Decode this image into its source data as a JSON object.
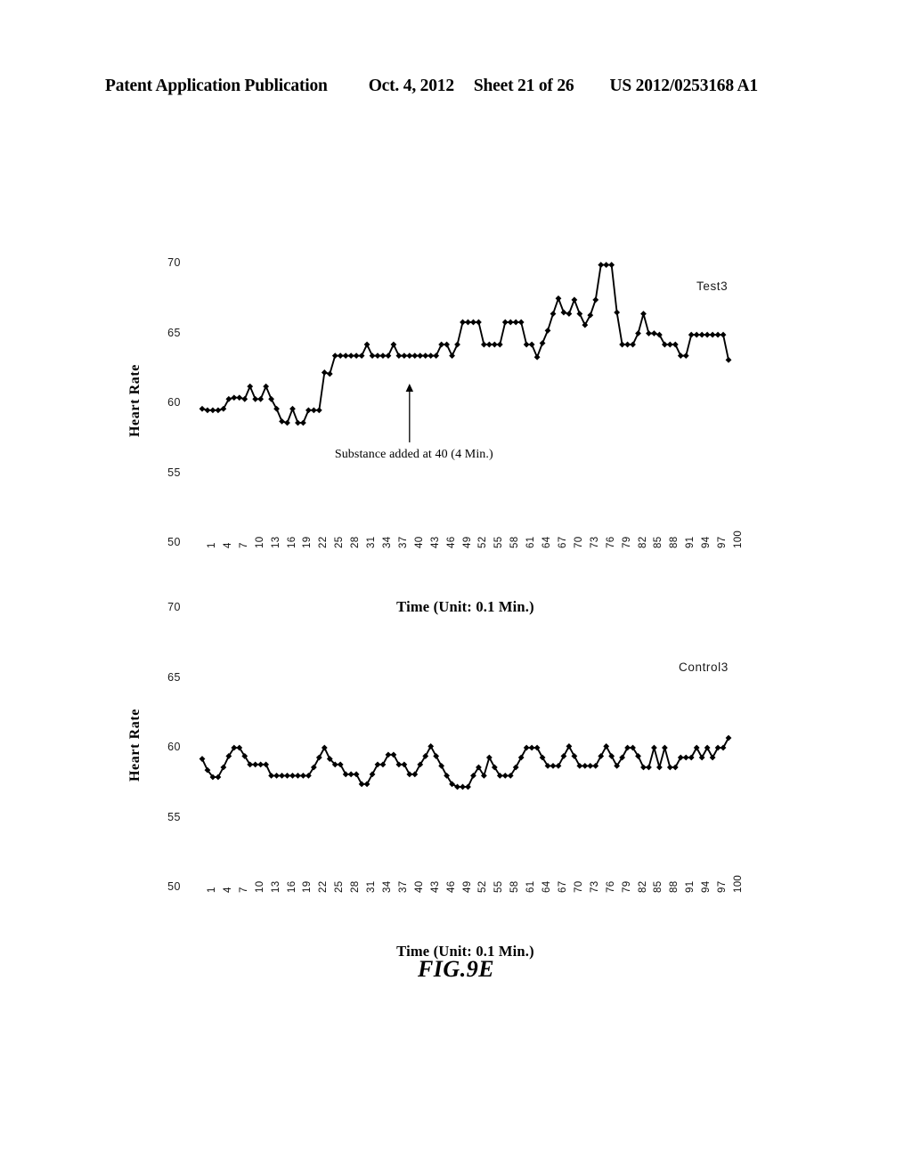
{
  "header": {
    "publication": "Patent Application Publication",
    "date": "Oct. 4, 2012",
    "sheet": "Sheet 21 of 26",
    "doc_number": "US 2012/0253168 A1"
  },
  "figure": {
    "caption": "FIG.9E"
  },
  "colors": {
    "ink": "#000000",
    "background": "#ffffff"
  },
  "chart_data": [
    {
      "id": "test3",
      "type": "line",
      "title": "",
      "series_label": "Test3",
      "xlabel": "Time (Unit: 0.1 Min.)",
      "ylabel": "Heart Rate",
      "ylim": [
        50,
        70
      ],
      "yticks": [
        50,
        55,
        60,
        65,
        70
      ],
      "xlim": [
        1,
        100
      ],
      "xticks": [
        1,
        4,
        7,
        10,
        13,
        16,
        19,
        22,
        25,
        28,
        31,
        34,
        37,
        40,
        43,
        46,
        49,
        52,
        55,
        58,
        61,
        64,
        67,
        70,
        73,
        76,
        79,
        82,
        85,
        88,
        91,
        94,
        97,
        100
      ],
      "grid": false,
      "marker": "diamond",
      "legend_position": "top-right-inside",
      "annotation": {
        "text": "Substance added at 40 (4 Min.)",
        "arrow_at_x": 40,
        "arrow_from_y": 57.2,
        "arrow_to_y": 61.4
      },
      "x": [
        1,
        2,
        3,
        4,
        5,
        6,
        7,
        8,
        9,
        10,
        11,
        12,
        13,
        14,
        15,
        16,
        17,
        18,
        19,
        20,
        21,
        22,
        23,
        24,
        25,
        26,
        27,
        28,
        29,
        30,
        31,
        32,
        33,
        34,
        35,
        36,
        37,
        38,
        39,
        40,
        41,
        42,
        43,
        44,
        45,
        46,
        47,
        48,
        49,
        50,
        51,
        52,
        53,
        54,
        55,
        56,
        57,
        58,
        59,
        60,
        61,
        62,
        63,
        64,
        65,
        66,
        67,
        68,
        69,
        70,
        71,
        72,
        73,
        74,
        75,
        76,
        77,
        78,
        79,
        80,
        81,
        82,
        83,
        84,
        85,
        86,
        87,
        88,
        89,
        90,
        91,
        92,
        93,
        94,
        95,
        96,
        97,
        98,
        99,
        100
      ],
      "values": [
        59.6,
        59.5,
        59.5,
        59.5,
        59.6,
        60.3,
        60.4,
        60.4,
        60.3,
        61.2,
        60.3,
        60.3,
        61.2,
        60.3,
        59.6,
        58.7,
        58.6,
        59.6,
        58.6,
        58.6,
        59.5,
        59.5,
        59.5,
        62.2,
        62.1,
        63.4,
        63.4,
        63.4,
        63.4,
        63.4,
        63.4,
        64.2,
        63.4,
        63.4,
        63.4,
        63.4,
        64.2,
        63.4,
        63.4,
        63.4,
        63.4,
        63.4,
        63.4,
        63.4,
        63.4,
        64.2,
        64.2,
        63.4,
        64.2,
        65.8,
        65.8,
        65.8,
        65.8,
        64.2,
        64.2,
        64.2,
        64.2,
        65.8,
        65.8,
        65.8,
        65.8,
        64.2,
        64.2,
        63.3,
        64.3,
        65.2,
        66.4,
        67.5,
        66.5,
        66.4,
        67.4,
        66.4,
        65.6,
        66.3,
        67.4,
        69.9,
        69.9,
        69.9,
        66.5,
        64.2,
        64.2,
        64.2,
        65.0,
        66.4,
        65.0,
        65.0,
        64.9,
        64.2,
        64.2,
        64.2,
        63.4,
        63.4,
        64.9,
        64.9,
        64.9,
        64.9,
        64.9,
        64.9,
        64.9,
        63.1
      ]
    },
    {
      "id": "control3",
      "type": "line",
      "title": "",
      "series_label": "Control3",
      "xlabel": "Time (Unit: 0.1 Min.)",
      "ylabel": "Heart Rate",
      "ylim": [
        50,
        70
      ],
      "yticks": [
        50,
        55,
        60,
        65,
        70
      ],
      "xlim": [
        1,
        100
      ],
      "xticks": [
        1,
        4,
        7,
        10,
        13,
        16,
        19,
        22,
        25,
        28,
        31,
        34,
        37,
        40,
        43,
        46,
        49,
        52,
        55,
        58,
        61,
        64,
        67,
        70,
        73,
        76,
        79,
        82,
        85,
        88,
        91,
        94,
        97,
        100
      ],
      "grid": false,
      "marker": "diamond",
      "legend_position": "top-right-inside",
      "x": [
        1,
        2,
        3,
        4,
        5,
        6,
        7,
        8,
        9,
        10,
        11,
        12,
        13,
        14,
        15,
        16,
        17,
        18,
        19,
        20,
        21,
        22,
        23,
        24,
        25,
        26,
        27,
        28,
        29,
        30,
        31,
        32,
        33,
        34,
        35,
        36,
        37,
        38,
        39,
        40,
        41,
        42,
        43,
        44,
        45,
        46,
        47,
        48,
        49,
        50,
        51,
        52,
        53,
        54,
        55,
        56,
        57,
        58,
        59,
        60,
        61,
        62,
        63,
        64,
        65,
        66,
        67,
        68,
        69,
        70,
        71,
        72,
        73,
        74,
        75,
        76,
        77,
        78,
        79,
        80,
        81,
        82,
        83,
        84,
        85,
        86,
        87,
        88,
        89,
        90,
        91,
        92,
        93,
        94,
        95,
        96,
        97,
        98,
        99,
        100
      ],
      "values": [
        59.2,
        58.4,
        57.9,
        57.9,
        58.6,
        59.4,
        60.0,
        60.0,
        59.4,
        58.8,
        58.8,
        58.8,
        58.8,
        58.0,
        58.0,
        58.0,
        58.0,
        58.0,
        58.0,
        58.0,
        58.0,
        58.6,
        59.3,
        60.0,
        59.2,
        58.8,
        58.8,
        58.1,
        58.1,
        58.1,
        57.4,
        57.4,
        58.1,
        58.8,
        58.8,
        59.5,
        59.5,
        58.8,
        58.8,
        58.1,
        58.1,
        58.8,
        59.4,
        60.1,
        59.4,
        58.7,
        58.0,
        57.4,
        57.2,
        57.2,
        57.2,
        58.0,
        58.6,
        58.0,
        59.3,
        58.6,
        58.0,
        58.0,
        58.0,
        58.6,
        59.3,
        60.0,
        60.0,
        60.0,
        59.3,
        58.7,
        58.7,
        58.7,
        59.4,
        60.1,
        59.4,
        58.7,
        58.7,
        58.7,
        58.7,
        59.4,
        60.1,
        59.4,
        58.7,
        59.3,
        60.0,
        60.0,
        59.4,
        58.6,
        58.6,
        60.0,
        58.6,
        60.0,
        58.6,
        58.6,
        59.3,
        59.3,
        59.3,
        60.0,
        59.3,
        60.0,
        59.3,
        60.0,
        60.0,
        60.7
      ]
    }
  ]
}
